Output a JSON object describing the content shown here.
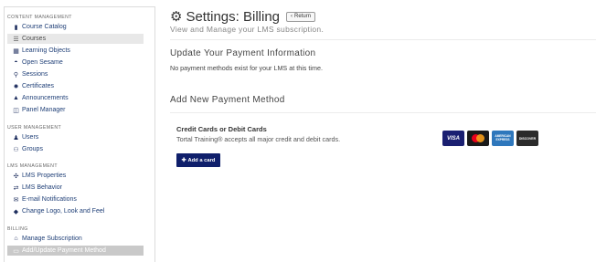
{
  "sidebar": {
    "sections": [
      {
        "title": "CONTENT MANAGEMENT",
        "items": [
          {
            "label": "Course Catalog",
            "icon": "book-icon"
          },
          {
            "label": "Courses",
            "icon": "list-icon",
            "active": true
          },
          {
            "label": "Learning Objects",
            "icon": "grid-icon"
          },
          {
            "label": "Open Sesame",
            "icon": "open-sesame-icon"
          },
          {
            "label": "Sessions",
            "icon": "map-marker-icon"
          },
          {
            "label": "Certificates",
            "icon": "certificate-icon"
          },
          {
            "label": "Announcements",
            "icon": "bell-icon"
          },
          {
            "label": "Panel Manager",
            "icon": "panel-icon"
          }
        ]
      },
      {
        "title": "USER MANAGEMENT",
        "items": [
          {
            "label": "Users",
            "icon": "user-icon"
          },
          {
            "label": "Groups",
            "icon": "group-icon"
          }
        ]
      },
      {
        "title": "LMS MANAGEMENT",
        "items": [
          {
            "label": "LMS Properties",
            "icon": "sitemap-icon"
          },
          {
            "label": "LMS Behavior",
            "icon": "exchange-icon"
          },
          {
            "label": "E-mail Notifications",
            "icon": "envelope-icon"
          },
          {
            "label": "Change Logo, Look and Feel",
            "icon": "tint-icon"
          }
        ]
      },
      {
        "title": "BILLING",
        "items": [
          {
            "label": "Manage Subscription",
            "icon": "bank-icon"
          },
          {
            "label": "Add/Update Payment Method",
            "icon": "credit-card-icon",
            "active": true
          }
        ]
      }
    ]
  },
  "header": {
    "title": "Settings: Billing",
    "return_label": "Return",
    "subtitle": "View and Manage your LMS subscription."
  },
  "payment_info": {
    "heading": "Update Your Payment Information",
    "note": "No payment methods exist for your LMS at this time."
  },
  "new_method": {
    "heading": "Add New Payment Method",
    "card_title": "Credit Cards or Debit Cards",
    "card_desc": "Tortal Training® accepts all major credit and debit cards.",
    "add_button": "Add a card",
    "card_brands": [
      "VISA",
      "Mastercard",
      "AMERICAN EXPRESS",
      "DISCOVER"
    ]
  },
  "colors": {
    "nav_link": "#1f3f77",
    "add_button_bg": "#0f1f6b",
    "visa": "#1a1f71",
    "amex": "#2e77bc"
  }
}
